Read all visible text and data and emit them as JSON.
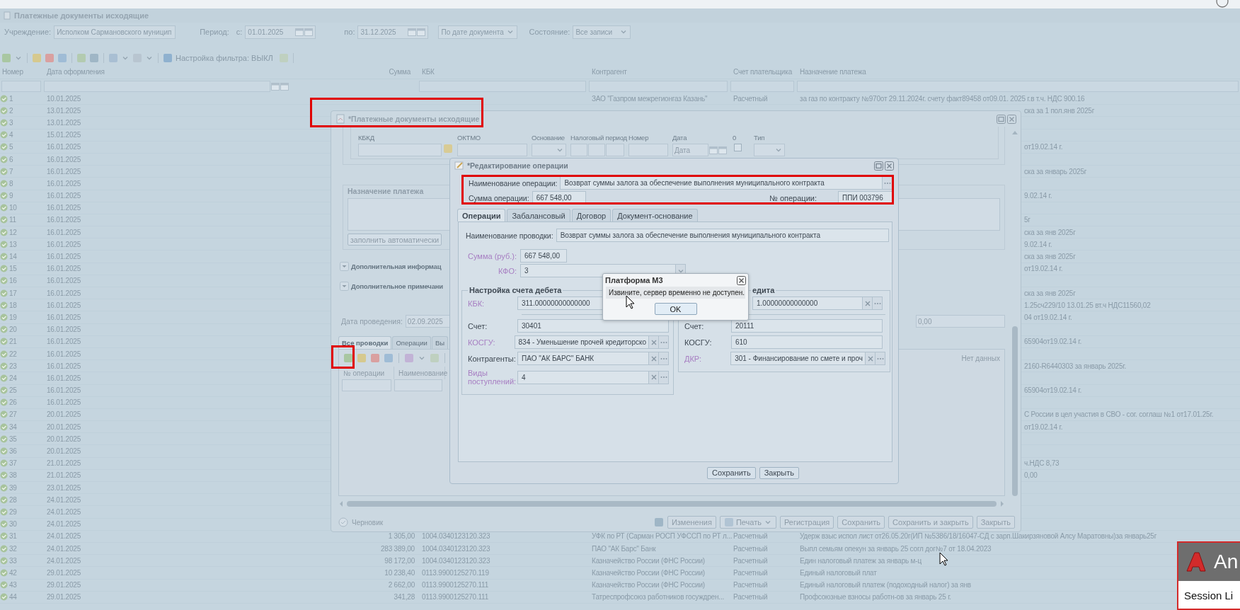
{
  "app": {
    "title": "Платежные документы исходящие"
  },
  "filters": {
    "org_label": "Учреждение:",
    "org_value": "Исполком Сармановского муницип",
    "period_label": "Период:",
    "from_label": "с:",
    "from_value": "01.01.2025",
    "to_label": "по:",
    "to_value": "31.12.2025",
    "mode_value": "По дате документа",
    "state_label": "Состояние:",
    "state_value": "Все записи"
  },
  "toolbar": {
    "filter_label": "Настройка фильтра: ВЫКЛ"
  },
  "table": {
    "columns": [
      "Номер",
      "Дата оформления",
      "Сумма",
      "КБК",
      "Контрагент",
      "Счет плательщика",
      "Назначение платежа"
    ],
    "rows": [
      {
        "number": "1",
        "date": "10.01.2025",
        "contractor": "ЗАО \"Газпром межрегионгаз Казань\"",
        "account": "Расчетный",
        "purpose": "за газ по контракту №970от 29.11.2024г. счету факт89458 от09.01. 2025 г.в т.ч. НДС 900.16"
      },
      {
        "number": "2",
        "date": "13.01.2025",
        "purpose_tail": "ска за 1 пол.янв 2025г"
      },
      {
        "number": "3",
        "date": "13.01.2025"
      },
      {
        "number": "4",
        "date": "15.01.2025"
      },
      {
        "number": "5",
        "date": "16.01.2025",
        "purpose_tail": "от19.02.14 г."
      },
      {
        "number": "6",
        "date": "16.01.2025"
      },
      {
        "number": "7",
        "date": "16.01.2025",
        "purpose_tail": "ска за январь 2025г"
      },
      {
        "number": "8",
        "date": "16.01.2025"
      },
      {
        "number": "9",
        "date": "16.01.2025",
        "purpose_tail": "9.02.14 г."
      },
      {
        "number": "10",
        "date": "16.01.2025"
      },
      {
        "number": "11",
        "date": "16.01.2025",
        "purpose_tail": "5г"
      },
      {
        "number": "12",
        "date": "16.01.2025",
        "purpose_tail": "ска за янв 2025г"
      },
      {
        "number": "13",
        "date": "16.01.2025",
        "purpose_tail": "9.02.14 г."
      },
      {
        "number": "14",
        "date": "16.01.2025",
        "purpose_tail": "ска за янв 2025г"
      },
      {
        "number": "15",
        "date": "16.01.2025",
        "purpose_tail": "от19.02.14 г."
      },
      {
        "number": "16",
        "date": "16.01.2025"
      },
      {
        "number": "17",
        "date": "16.01.2025",
        "purpose_tail": "ска за янв 2025г"
      },
      {
        "number": "18",
        "date": "16.01.2025",
        "purpose_tail": "1.25сч229/10 13.01.25 вт.ч НДС11560,02"
      },
      {
        "number": "19",
        "date": "16.01.2025",
        "purpose_tail": "04 от19.02.14 г."
      },
      {
        "number": "20",
        "date": "16.01.2025"
      },
      {
        "number": "21",
        "date": "16.01.2025",
        "purpose_tail": "65904от19.02.14 г."
      },
      {
        "number": "22",
        "date": "16.01.2025"
      },
      {
        "number": "23",
        "date": "16.01.2025",
        "purpose_tail": "2160-R6440303 за январь 2025г."
      },
      {
        "number": "24",
        "date": "16.01.2025"
      },
      {
        "number": "25",
        "date": "16.01.2025",
        "purpose_tail": "65904от19.02.14 г."
      },
      {
        "number": "26",
        "date": "16.01.2025"
      },
      {
        "number": "27",
        "date": "20.01.2025",
        "purpose_tail": "С России в цел участия в СВО - сог. соглаш №1 от17.01.25г."
      },
      {
        "number": "34",
        "date": "20.01.2025",
        "purpose_tail": "от19.02.14 г."
      },
      {
        "number": "35",
        "date": "20.01.2025"
      },
      {
        "number": "36",
        "date": "20.01.2025"
      },
      {
        "number": "37",
        "date": "21.01.2025",
        "purpose_tail": "ч.НДС 8,73"
      },
      {
        "number": "38",
        "date": "21.01.2025",
        "purpose_tail": "0,00"
      },
      {
        "number": "39",
        "date": "23.01.2025"
      },
      {
        "number": "28",
        "date": "24.01.2025"
      },
      {
        "number": "29",
        "date": "24.01.2025"
      },
      {
        "number": "30",
        "date": "24.01.2025"
      },
      {
        "number": "31",
        "date": "24.01.2025",
        "sum": "1 305,00",
        "kbk": "1004.0340123120.323",
        "contractor": "УФК по РТ (Сарман РОСП УФССП по РТ л...",
        "account": "Расчетный",
        "purpose": "Удерж взыс испол лист от26.05.20г(ИП №5386/18/16047-СД с зарп.Шакирзяновой Алсу Маратовны)за январь25г"
      },
      {
        "number": "32",
        "date": "24.01.2025",
        "sum": "283 389,00",
        "kbk": "1004.0340123120.323",
        "contractor": "ПАО \"АК Барс\" Банк",
        "account": "Расчетный",
        "purpose": "Выпл семьям опекун за январь 25 согл дог№7 от 18.04.2023"
      },
      {
        "number": "33",
        "date": "24.01.2025",
        "sum": "98 172,00",
        "kbk": "1004.0340123120.323",
        "contractor": "Казначейство России (ФНС России)",
        "account": "Расчетный",
        "purpose": "Един налоговый платеж за январь м-ц"
      },
      {
        "number": "42",
        "date": "29.01.2025",
        "sum": "10 238,40",
        "kbk": "0113.9900125270.119",
        "contractor": "Казначейство России (ФНС России)",
        "account": "Расчетный",
        "purpose": "Единый налоговый плат"
      },
      {
        "number": "43",
        "date": "29.01.2025",
        "sum": "2 662,00",
        "kbk": "0113.9900125270.111",
        "contractor": "Казначейство России (ФНС России)",
        "account": "Расчетный",
        "purpose": "Единый налоговый платеж (подоходный налог) за янв"
      },
      {
        "number": "44",
        "date": "29.01.2025",
        "sum": "341,28",
        "kbk": "0113.9900125270.111",
        "contractor": "Татреспрофсоюз работников госуждрен...",
        "account": "Расчетный",
        "purpose": "Профсоюзные взносы работн-ов за январь 25 г."
      }
    ]
  },
  "document_window": {
    "title": "*Платежные документы исходящие",
    "tax_fields": [
      {
        "label": "КБКД",
        "kind": "lookup"
      },
      {
        "label": "ОКТМО",
        "kind": "text"
      },
      {
        "label": "Основание",
        "kind": "combo"
      },
      {
        "label": "Налоговый период",
        "kind": "period"
      },
      {
        "label": "Номер",
        "kind": "text"
      },
      {
        "label": "Дата",
        "kind": "date",
        "placeholder": "Дата"
      },
      {
        "label": "0",
        "kind": "checkbox",
        "checked": false
      },
      {
        "label": "Тип",
        "kind": "combo"
      }
    ],
    "purpose_title": "Назначение платежа",
    "fill_button": "заполнить автоматически",
    "sections": [
      "Дополнительная информац",
      "Дополнительное примечани"
    ],
    "posting_date_label": "Дата проведения:",
    "posting_date_value": "02.09.2025",
    "amount_value": "0,00",
    "tabs": [
      {
        "label": "Все проводки",
        "selected": true
      },
      {
        "label": "Операции",
        "selected": false
      },
      {
        "label": "Вы",
        "selected": false
      }
    ],
    "grid_columns": [
      "№ операции",
      "Наименование"
    ],
    "empty_text": "Нет данных",
    "status": "Черновик",
    "buttons": [
      {
        "label": "Изменения",
        "kind": "plain"
      },
      {
        "label": "Печать",
        "kind": "menu"
      },
      {
        "label": "Регистрация",
        "kind": "plain"
      },
      {
        "label": "Сохранить",
        "kind": "plain"
      },
      {
        "label": "Сохранить и закрыть",
        "kind": "plain"
      },
      {
        "label": "Закрыть",
        "kind": "plain"
      }
    ]
  },
  "operation_window": {
    "title": "*Редактирование операции",
    "name_label": "Наименование операции:",
    "name_value": "Возврат суммы залога за обеспечение выполнения муниципального контракта",
    "sum_label": "Сумма операции:",
    "sum_value": "667 548,00",
    "number_label": "№ операции:",
    "number_value": "ППИ 003796",
    "tabs": [
      {
        "label": "Операции",
        "selected": true
      },
      {
        "label": "Забалансовый",
        "selected": false
      },
      {
        "label": "Договор",
        "selected": false
      },
      {
        "label": "Документ-основание",
        "selected": false
      }
    ],
    "posting_label": "Наименование проводки:",
    "posting_value": "Возврат суммы залога за обеспечение выполнения муниципального контракта",
    "amount": {
      "label": "Сумма (руб.):",
      "value": "667 548,00",
      "required": true
    },
    "kfo": {
      "label": "КФО:",
      "value": "3",
      "required": true
    },
    "debit": {
      "title": "Настройка счета дебета",
      "fields": [
        {
          "label": "КБК:",
          "value": "311.00000000000000",
          "kind": "text",
          "required": true
        },
        {
          "label": "Счет:",
          "value": "30401",
          "kind": "text",
          "required": false
        },
        {
          "label": "КОСГУ:",
          "value": "834 - Уменьшение прочей кредиторско",
          "kind": "lookup",
          "required": true
        },
        {
          "label": "Контрагенты:",
          "value": "ПАО \"АК БАРС\" БАНК",
          "kind": "lookup",
          "required": false
        },
        {
          "label": "Виды поступлений:",
          "value": "4",
          "kind": "lookup",
          "required": true
        }
      ]
    },
    "credit": {
      "title": "едита",
      "fields": [
        {
          "value": "1.00000000000000",
          "kind": "lookup",
          "required": false
        },
        {
          "label": "Счет:",
          "value": "20111",
          "kind": "text",
          "required": false
        },
        {
          "label": "КОСГУ:",
          "value": "610",
          "kind": "text",
          "required": false
        },
        {
          "label": "ДКР:",
          "value": "301 - Финансирование по смете и проч",
          "kind": "lookup",
          "required": true
        }
      ]
    },
    "buttons": [
      "Сохранить",
      "Закрыть"
    ]
  },
  "message_box": {
    "title": "Платформа М3",
    "message": "Извините, сервер временно не доступен.",
    "button": "OK"
  },
  "notification": {
    "title": "An",
    "text": "Session Li"
  }
}
